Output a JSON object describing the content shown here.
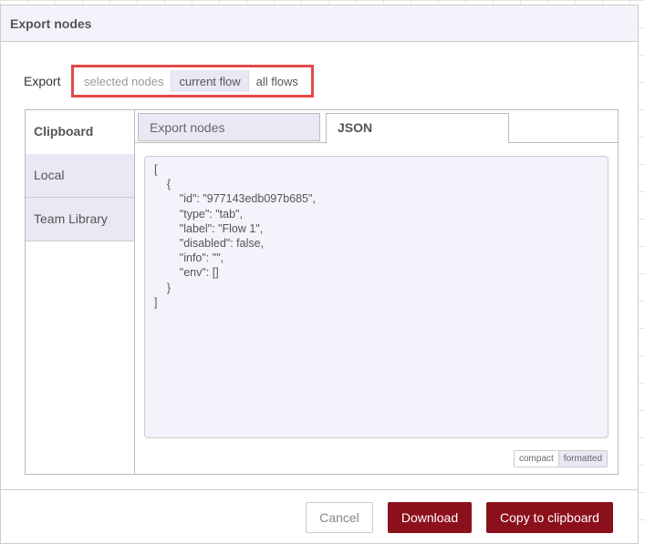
{
  "dialog": {
    "title": "Export nodes"
  },
  "export": {
    "label": "Export",
    "options": [
      "selected nodes",
      "current flow",
      "all flows"
    ],
    "selected": "current flow"
  },
  "sidebar": {
    "items": [
      "Clipboard",
      "Local",
      "Team Library"
    ],
    "selected": "Clipboard"
  },
  "tabs": [
    "Export nodes",
    "JSON"
  ],
  "active_tab": "JSON",
  "json_text": "[\n    {\n        \"id\": \"977143edb097b685\",\n        \"type\": \"tab\",\n        \"label\": \"Flow 1\",\n        \"disabled\": false,\n        \"info\": \"\",\n        \"env\": []\n    }\n]",
  "format": {
    "options": [
      "compact",
      "formatted"
    ],
    "selected": "formatted"
  },
  "buttons": {
    "cancel": "Cancel",
    "download": "Download",
    "copy": "Copy to clipboard"
  },
  "colors": {
    "primary": "#8c101c",
    "highlight": "#e54848"
  }
}
